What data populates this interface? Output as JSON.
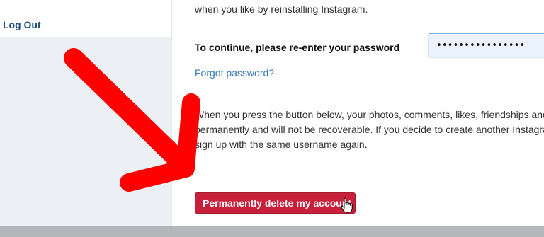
{
  "sidebar": {
    "logout_label": "Log Out"
  },
  "main": {
    "intro_text": "when you like by reinstalling Instagram.",
    "password_label": "To continue, please re-enter your password",
    "password_value": "••••••••••••••••",
    "forgot_link": "Forgot password?",
    "warning_lines": [
      "When you press the button below, your photos, comments, likes, friendships and",
      "permanently and will not be recoverable. If you decide to create another Instagra",
      "sign up with the same username again."
    ],
    "delete_button_label": "Permanently delete my account"
  },
  "colors": {
    "delete_button": "#c8203a",
    "link": "#3a7ab6",
    "arrow": "#ff0000"
  },
  "icons": {
    "cursor": "hand-pointer-icon",
    "arrow": "red-arrow-icon"
  }
}
